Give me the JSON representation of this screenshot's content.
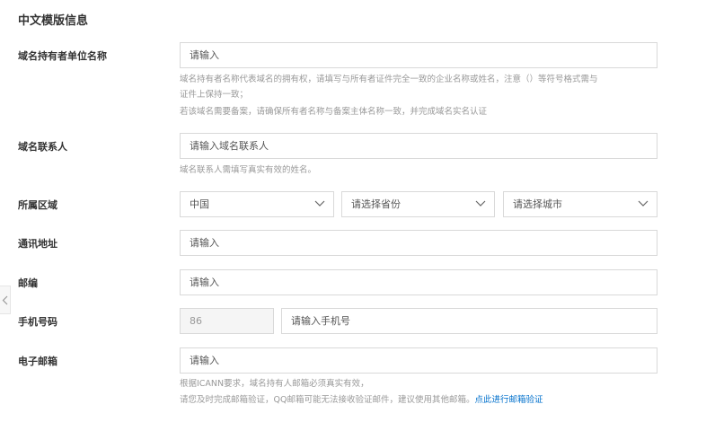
{
  "section": {
    "title": "中文模版信息"
  },
  "fields": {
    "org_name": {
      "label": "域名持有者单位名称",
      "placeholder": "请输入",
      "hint_line1": "域名持有者名称代表域名的拥有权，请填写与所有者证件完全一致的企业名称或姓名，注意（）等符号格式需与",
      "hint_line2": "证件上保持一致；",
      "hint_line3": "若该域名需要备案，请确保所有者名称与备案主体名称一致，并完成域名实名认证"
    },
    "contact": {
      "label": "域名联系人",
      "placeholder": "请输入域名联系人",
      "hint": "域名联系人需填写真实有效的姓名。"
    },
    "region": {
      "label": "所属区域",
      "country": "中国",
      "province_placeholder": "请选择省份",
      "city_placeholder": "请选择城市"
    },
    "address": {
      "label": "通讯地址",
      "placeholder": "请输入"
    },
    "postcode": {
      "label": "邮编",
      "placeholder": "请输入"
    },
    "phone": {
      "label": "手机号码",
      "country_code": "86",
      "placeholder": "请输入手机号"
    },
    "email": {
      "label": "电子邮箱",
      "placeholder": "请输入",
      "hint_line1": "根据ICANN要求，域名持有人邮箱必须真实有效，",
      "hint_line2": "请您及时完成邮箱验证，QQ邮箱可能无法接收验证邮件，建议使用其他邮箱。",
      "verify_link": "点此进行邮箱验证"
    }
  },
  "icons": {
    "select_arrow": "chevron-down-icon",
    "side_toggle": "chevron-left-icon"
  },
  "colors": {
    "link": "#0070cc",
    "border": "#d9d9d9",
    "hint": "#999999"
  }
}
